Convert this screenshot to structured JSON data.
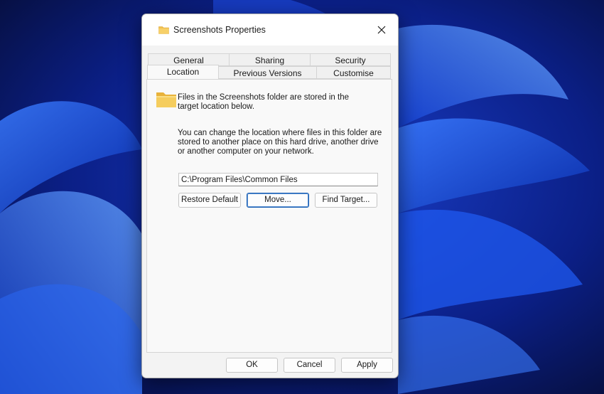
{
  "dialog": {
    "title": "Screenshots Properties",
    "close_icon": "close-icon",
    "folder_icon": "folder-icon"
  },
  "tabs": {
    "row1": [
      {
        "label": "General"
      },
      {
        "label": "Sharing"
      },
      {
        "label": "Security"
      }
    ],
    "row2": [
      {
        "label": "Location",
        "active": true
      },
      {
        "label": "Previous Versions"
      },
      {
        "label": "Customise"
      }
    ]
  },
  "location": {
    "info": "Files in the Screenshots folder are stored in the target location below.",
    "description": "You can change the location where files in this folder are stored to another place on this hard drive, another drive or another computer on your network.",
    "path_value": "C:\\Program Files\\Common Files",
    "restore_label": "Restore Default",
    "move_label": "Move...",
    "find_label": "Find Target..."
  },
  "footer": {
    "ok_label": "OK",
    "cancel_label": "Cancel",
    "apply_label": "Apply"
  },
  "colors": {
    "accent": "#1a5fb4",
    "folder": "#f2c14e",
    "wallpaper": "#0a1a6b"
  }
}
